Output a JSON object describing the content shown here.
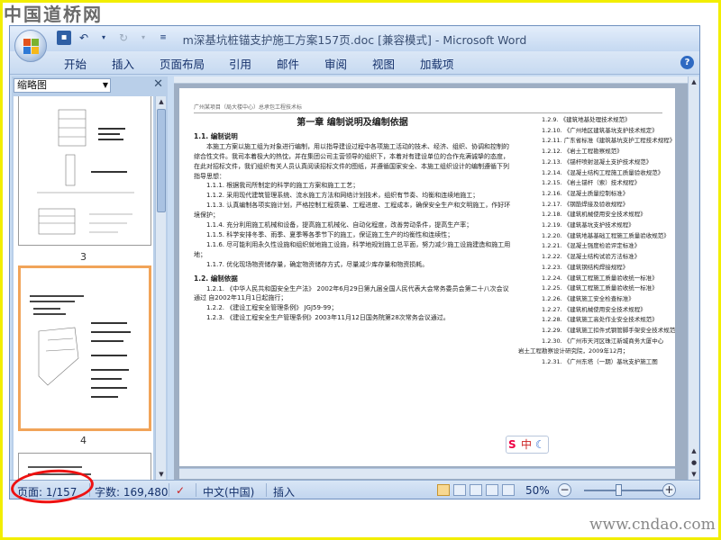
{
  "watermark_top": "中国道桥网",
  "watermark_bottom": "www.cndao.com",
  "window": {
    "title": "m深基坑桩锚支护施工方案157页.doc [兼容模式] - Microsoft Word"
  },
  "ribbon": {
    "tabs": [
      "开始",
      "插入",
      "页面布局",
      "引用",
      "邮件",
      "审阅",
      "视图",
      "加载项"
    ],
    "help_icon": "question-icon"
  },
  "nav_pane": {
    "mode": "缩略图",
    "thumbnails": [
      {
        "page": "3"
      },
      {
        "page": "4"
      }
    ]
  },
  "document": {
    "header_text": "广州某项目（局大楼中心）总承包工程技术标",
    "chapter_title": "第一章 编制说明及编制依据",
    "sec1_title": "1.1. 编制说明",
    "sec1_paragraph": "本施工方案以施工组为对象进行编制，用以指导建设过程中各项施工活动的技术、经济、组织、协调和控制的综合性文件。我司本着极大的热忱，并在集团公司主营领导的组织下，本着对有建设单位的合作充满诚挚的态度，在此对招标文件，我们组织有关人员认真阅读招标文件的图纸，并遵循国家安全、本施工组织设计的编制遵循下列指导思想：",
    "sec1_items": [
      "1.1.1. 根据我司所制定的科学的施工方案和施工工艺；",
      "1.1.2. 采用现代建筑管理系统、流水施工方法和网络计划技术，组织有节奏、均衡和连续地施工；",
      "1.1.3. 认真编制各项实施计划，严格控制工程质量、工程进度、工程成本，确保安全生产和文明施工，作好环境保护；",
      "1.1.4. 充分利用施工机械和设备，提高施工机械化、自动化程度，改善劳动条件，提高生产率；",
      "1.1.5. 科学安排冬季、雨季、夏季等各季节下的施工，保证施工生产的均衡性和连续性；",
      "1.1.6. 尽可能利用永久性设施和组织就地施工设施，科学地规划施工总平面，努力减少施工设施建造和施工用地；",
      "1.1.7. 优化现场物资储存量，确定物资储存方式，尽量减少库存量和物资损耗。"
    ],
    "sec2_title": "1.2. 编制依据",
    "sec2_items": [
      "1.2.1. 《中华人民共和国安全生产法》 2002年6月29日第九届全国人民代表大会常务委员会第二十八次会议通过 自2002年11月1日起施行；",
      "1.2.2. 《建设工程安全管理条例》 JGJ59-99；",
      "1.2.3. 《建设工程安全生产管理条例》2003年11月12日国务院第28次常务会议通过。"
    ],
    "right_column": [
      "1.2.9. 《建筑地基处理技术规范》",
      "1.2.10. 《广州地区建筑基坑支护技术规定》",
      "1.2.11. 广东省标准《建筑基坑支护工程技术规程》",
      "1.2.12. 《岩土工程勘察规范》",
      "1.2.13. 《锚杆喷射混凝土支护技术规范》",
      "1.2.14. 《混凝土结构工程施工质量验收规范》",
      "1.2.15. 《岩土锚杆（索）技术规程》",
      "1.2.16. 《混凝土质量控制标准》",
      "1.2.17. 《钢筋焊接及验收规程》",
      "1.2.18. 《建筑机械使用安全技术规程》",
      "1.2.19. 《建筑基坑支护技术规程》",
      "1.2.20. 《建筑地基基础工程施工质量验收规范》",
      "1.2.21. 《混凝土强度检验评定标准》",
      "1.2.22. 《混凝土结构试验方法标准》",
      "1.2.23. 《建筑钢结构焊接规程》",
      "1.2.24. 《建筑工程施工质量验收统一标准》",
      "1.2.25. 《建筑工程施工质量验收统一标准》",
      "1.2.26. 《建筑施工安全检查标准》",
      "1.2.27. 《建筑机械使用安全技术规程》",
      "1.2.28. 《建筑施工高处作业安全技术规范》",
      "1.2.29. 《建筑施工扣件式钢管脚手架安全技术规范》",
      "1.2.30. 《广州市天河区珠江新城商务大厦中心",
      "岩土工程勘察设计研究院，2009年12月；",
      "1.2.31. 《广州东塔（一期）基坑支护施工图"
    ]
  },
  "status_bar": {
    "page_label": "页面: 1/157",
    "word_count": "字数: 169,480",
    "language": "中文(中国)",
    "mode": "插入",
    "zoom": "50%"
  },
  "ime_indicator": {
    "label": "中"
  },
  "colors": {
    "frame": "#f2ee00",
    "annotation_circle": "#e11111",
    "selected_thumb_border": "#f1a459",
    "office_blue": "#c9dcf2"
  }
}
